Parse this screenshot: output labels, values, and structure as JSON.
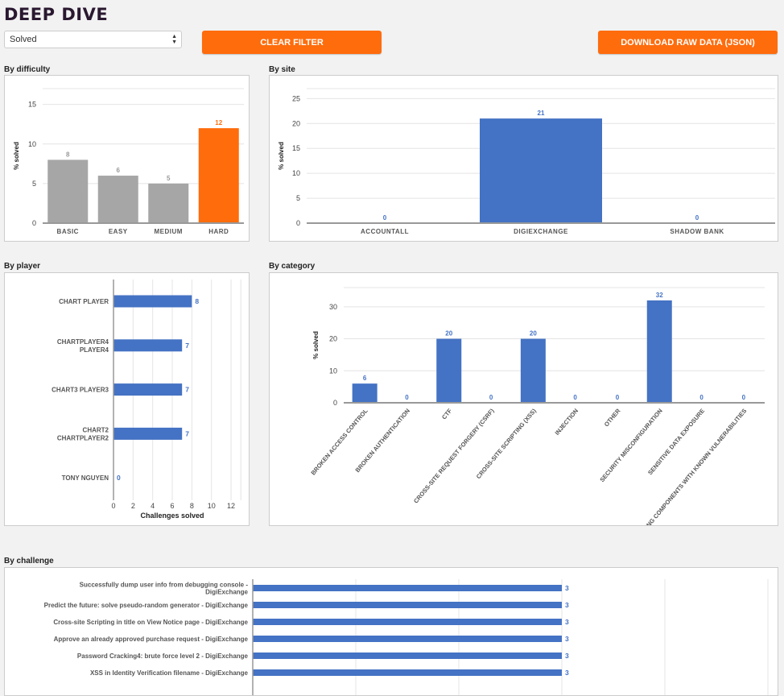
{
  "header": {
    "title": "DEEP DIVE"
  },
  "filter": {
    "selected": "Solved"
  },
  "buttons": {
    "clear_filter": "CLEAR FILTER",
    "download": "DOWNLOAD RAW DATA (JSON)"
  },
  "colors": {
    "accent": "#ff6c0c",
    "bar_blue": "#4472c4",
    "bar_gray": "#a6a6a6",
    "title": "#2a1830"
  },
  "sections": {
    "difficulty": "By difficulty",
    "site": "By site",
    "player": "By player",
    "category": "By category",
    "challenge": "By challenge"
  },
  "chart_data": [
    {
      "id": "difficulty",
      "type": "bar",
      "ylabel": "% solved",
      "ylim": [
        0,
        17
      ],
      "yticks": [
        0,
        5,
        10,
        15
      ],
      "grid": true,
      "categories": [
        "BASIC",
        "EASY",
        "MEDIUM",
        "HARD"
      ],
      "values": [
        8,
        6,
        5,
        12
      ],
      "highlight": "HARD"
    },
    {
      "id": "site",
      "type": "bar",
      "ylabel": "% solved",
      "ylim": [
        0,
        27
      ],
      "yticks": [
        0,
        5,
        10,
        15,
        20,
        25
      ],
      "grid": true,
      "categories": [
        "ACCOUNTALL",
        "DIGIEXCHANGE",
        "SHADOW BANK"
      ],
      "values": [
        0,
        21,
        0
      ]
    },
    {
      "id": "player",
      "type": "bar",
      "orientation": "horizontal",
      "xlabel": "Challenges solved",
      "xlim": [
        0,
        13
      ],
      "xticks": [
        0,
        2,
        4,
        6,
        8,
        10,
        12
      ],
      "grid": true,
      "categories": [
        [
          "CHART PLAYER"
        ],
        [
          "CHARTPLAYER4",
          "PLAYER4"
        ],
        [
          "CHART3 PLAYER3"
        ],
        [
          "CHART2",
          "CHARTPLAYER2"
        ],
        [
          "TONY NGUYEN"
        ]
      ],
      "values": [
        8,
        7,
        7,
        7,
        0
      ]
    },
    {
      "id": "category",
      "type": "bar",
      "ylabel": "% solved",
      "ylim": [
        0,
        36
      ],
      "yticks": [
        0,
        10,
        20,
        30
      ],
      "grid": true,
      "categories": [
        "BROKEN ACCESS CONTROL",
        "BROKEN AUTHENTICATION",
        "CTF",
        "CROSS-SITE REQUEST FORGERY (CSRF)",
        "CROSS-SITE SCRIPTING (XSS)",
        "INJECTION",
        "OTHER",
        "SECURITY MISCONFIGURATION",
        "SENSITIVE DATA EXPOSURE",
        "USING COMPONENTS WITH KNOWN VULNERABILITIES"
      ],
      "values": [
        6,
        0,
        20,
        0,
        20,
        0,
        0,
        32,
        0,
        0
      ]
    },
    {
      "id": "challenge",
      "type": "bar",
      "orientation": "horizontal",
      "xlim": [
        0,
        5
      ],
      "grid": true,
      "categories": [
        [
          "Successfully dump user info from debugging console -",
          "DigiExchange"
        ],
        [
          "Predict the future: solve pseudo-random generator - DigiExchange"
        ],
        [
          "Cross-site Scripting in title on View Notice page - DigiExchange"
        ],
        [
          "Approve an already approved purchase request - DigiExchange"
        ],
        [
          "Password Cracking4: brute force level 2 - DigiExchange"
        ],
        [
          "XSS in Identity Verification filename - DigiExchange"
        ]
      ],
      "values": [
        3,
        3,
        3,
        3,
        3,
        3
      ]
    }
  ]
}
